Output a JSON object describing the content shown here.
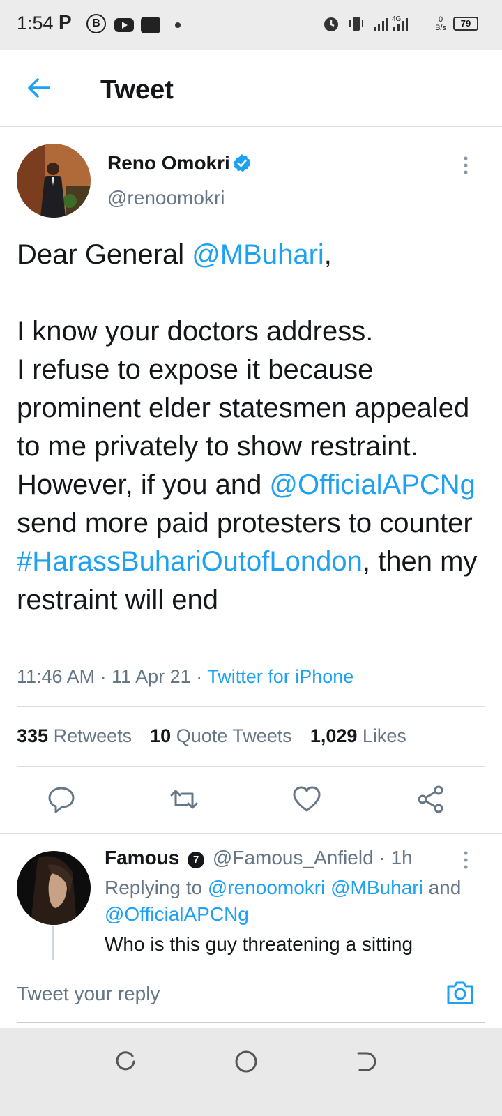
{
  "status_bar": {
    "time": "1:54",
    "app_letter": "P",
    "circle_letter": "B",
    "network": "4G",
    "speed_value": "0",
    "speed_unit": "B/s",
    "battery": "79",
    "icons": [
      "alarm-icon",
      "vibrate-icon",
      "signal-icon",
      "battery-icon"
    ]
  },
  "header": {
    "title": "Tweet"
  },
  "tweet": {
    "author_name": "Reno Omokri",
    "author_handle": "@renoomokri",
    "text_parts": [
      {
        "text": "Dear General ",
        "type": "plain"
      },
      {
        "text": "@MBuhari",
        "type": "mention"
      },
      {
        "text": ",\n\nI know your doctors address.\nI refuse to expose it because prominent elder statesmen appealed to me privately to show restraint. However, if you and ",
        "type": "plain"
      },
      {
        "text": "@OfficialAPCNg",
        "type": "mention"
      },
      {
        "text": " send more paid protesters to counter ",
        "type": "plain"
      },
      {
        "text": "#HarassBuhariOutofLondon",
        "type": "mention"
      },
      {
        "text": ", then my restraint will end",
        "type": "plain"
      }
    ],
    "time": "11:46 AM",
    "date": "11 Apr 21",
    "source": "Twitter for iPhone",
    "retweets_count": "335",
    "retweets_label": "Retweets",
    "quotes_count": "10",
    "quotes_label": "Quote Tweets",
    "likes_count": "1,029",
    "likes_label": "Likes"
  },
  "reply": {
    "name": "Famous",
    "badge": "7",
    "handle": "@Famous_Anfield",
    "age": "1h",
    "replying_label": "Replying to",
    "replying_to": "@renoomokri @MBuhari",
    "and_label": "and",
    "replying_to_2": "@OfficialAPCNg",
    "text": "Who is this guy threatening a sitting"
  },
  "composer": {
    "placeholder": "Tweet your reply"
  },
  "colors": {
    "accent": "#1da1f2",
    "secondary_text": "#657786",
    "primary_text": "#14171a"
  }
}
